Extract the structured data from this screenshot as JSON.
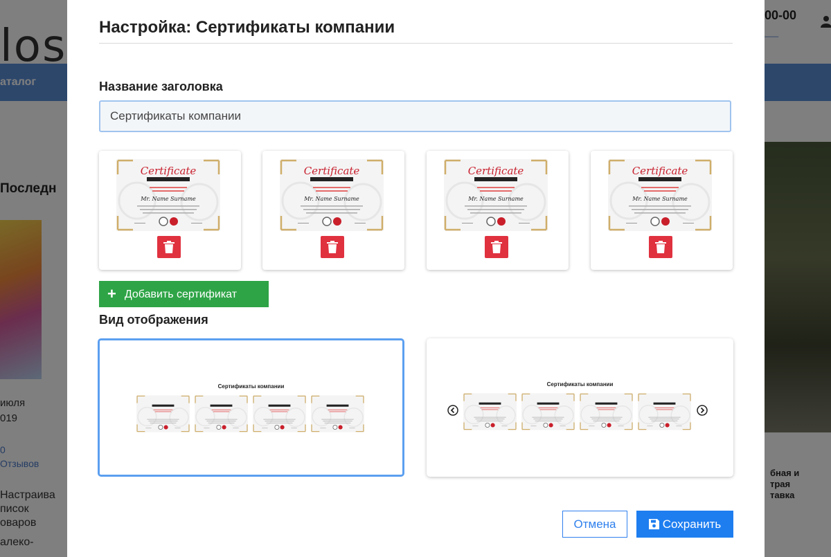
{
  "background": {
    "logo": "los",
    "phone": "00-00",
    "nav_item": "аталог",
    "heading": "Последн",
    "date_line1": "июля",
    "date_line2": "019",
    "reviews_count": "0",
    "reviews_label": "Отзывов",
    "desc_line1": "Настраива",
    "desc_line2": "писок",
    "desc_line3": "оваров",
    "desc_line4": "алеко-",
    "right_line1": "бная и",
    "right_line2": "трая",
    "right_line3": "тавка"
  },
  "modal": {
    "title": "Настройка: Сертификаты компании",
    "header_label": "Название заголовка",
    "header_input_value": "Сертификаты компании",
    "certificates": [
      {
        "heading": "Certificate",
        "name": "Mr. Name Surname"
      },
      {
        "heading": "Certificate",
        "name": "Mr. Name Surname"
      },
      {
        "heading": "Certificate",
        "name": "Mr. Name Surname"
      },
      {
        "heading": "Certificate",
        "name": "Mr. Name Surname"
      }
    ],
    "add_button_label": "Добавить сертификат",
    "view_label": "Вид отображения",
    "view_options": [
      {
        "preview_title": "Сертификаты компании",
        "selected": true
      },
      {
        "preview_title": "Сертификаты компании",
        "selected": false
      }
    ],
    "cancel_label": "Отмена",
    "save_label": "Сохранить"
  },
  "colors": {
    "accent": "#1e7ef0",
    "add": "#2ea446",
    "delete": "#e0313f",
    "selected_border": "#5b9ff0"
  }
}
